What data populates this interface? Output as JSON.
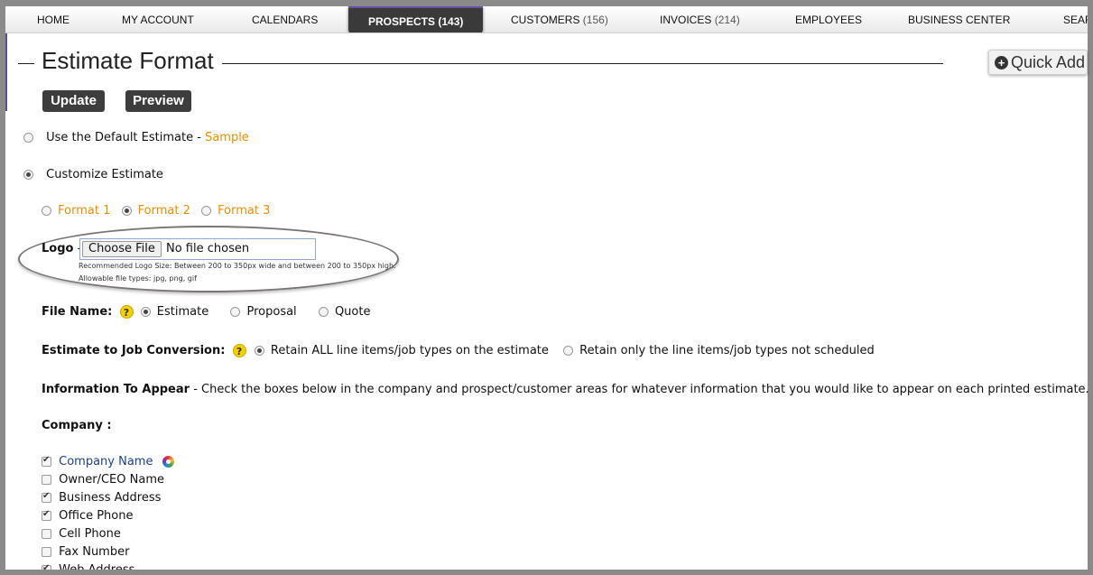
{
  "nav": {
    "items": [
      {
        "label": "HOME",
        "count": ""
      },
      {
        "label": "MY ACCOUNT",
        "count": ""
      },
      {
        "label": "CALENDARS",
        "count": ""
      },
      {
        "label": "PROSPECTS",
        "count": "(143)"
      },
      {
        "label": "CUSTOMERS",
        "count": "(156)"
      },
      {
        "label": "INVOICES",
        "count": "(214)"
      },
      {
        "label": "EMPLOYEES",
        "count": ""
      },
      {
        "label": "BUSINESS CENTER",
        "count": ""
      },
      {
        "label": "SEAR",
        "count": ""
      }
    ],
    "active": "PROSPECTS"
  },
  "page": {
    "title": "Estimate Format",
    "quick_add": "Quick Add",
    "update_label": "Update",
    "preview_label": "Preview"
  },
  "estimate_options": {
    "default_label": "Use the Default Estimate",
    "sample_link": "Sample",
    "customize_label": "Customize Estimate",
    "selected": "Customize Estimate",
    "formats": [
      "Format 1",
      "Format 2",
      "Format 3"
    ],
    "selected_format": "Format 2"
  },
  "logo": {
    "label": "Logo",
    "choose_button": "Choose File",
    "no_file_text": "No file chosen",
    "recommended": "Recommended Logo Size: Between 200 to 350px wide and between 200 to 350px high.",
    "allowable": "Allowable file types: jpg, png, gif"
  },
  "file_name": {
    "label": "File Name:",
    "options": [
      "Estimate",
      "Proposal",
      "Quote"
    ],
    "selected": "Estimate"
  },
  "conversion": {
    "label": "Estimate to Job Conversion:",
    "options": [
      "Retain ALL line items/job types on the estimate",
      "Retain only the line items/job types not scheduled"
    ],
    "selected": "Retain ALL line items/job types on the estimate"
  },
  "info": {
    "heading": "Information To Appear",
    "text": "Check the boxes below in the company and prospect/customer areas for whatever information that you would like to appear on each printed estimate."
  },
  "company": {
    "heading": "Company :",
    "fields": [
      {
        "label": "Company Name",
        "checked": true
      },
      {
        "label": "Owner/CEO Name",
        "checked": false
      },
      {
        "label": "Business Address",
        "checked": true
      },
      {
        "label": "Office Phone",
        "checked": true
      },
      {
        "label": "Cell Phone",
        "checked": false
      },
      {
        "label": "Fax Number",
        "checked": false
      },
      {
        "label": "Web Address",
        "checked": true
      }
    ]
  },
  "colors": {
    "accent_orange": "#f08c00",
    "nav_active_bg": "#3a3a3a",
    "help_yellow": "#f5d000",
    "link_blue": "#1f3f8f"
  }
}
